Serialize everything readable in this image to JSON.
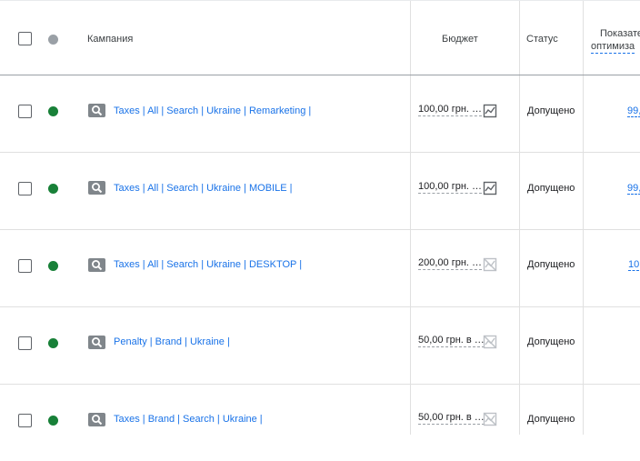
{
  "header": {
    "campaign_label": "Кампания",
    "budget_label": "Бюджет",
    "status_label": "Статус",
    "optimization_label_line1": "Показате",
    "optimization_label_line2": "оптимиза",
    "status_dot_color": "#9aa0a6"
  },
  "colors": {
    "enabled_dot": "#188038",
    "link": "#1a73e8"
  },
  "rows": [
    {
      "campaign": "Taxes | All | Search | Ukraine | Remarketing |",
      "budget": "100,00 грн. …",
      "chart_icon": "chart-line-icon",
      "status": "Допущено",
      "score": "99,"
    },
    {
      "campaign": "Taxes | All | Search | Ukraine | MOBILE |",
      "budget": "100,00 грн. …",
      "chart_icon": "chart-line-icon",
      "status": "Допущено",
      "score": "99,"
    },
    {
      "campaign": "Taxes | All | Search | Ukraine | DESKTOP |",
      "budget": "200,00 грн. …",
      "chart_icon": "chart-disabled-icon",
      "status": "Допущено",
      "score": "10"
    },
    {
      "campaign": "Penalty | Brand | Ukraine |",
      "budget": "50,00 грн. в …",
      "chart_icon": "chart-disabled-icon",
      "status": "Допущено",
      "score": ""
    },
    {
      "campaign": "Taxes | Brand | Search | Ukraine |",
      "budget": "50,00 грн. в …",
      "chart_icon": "chart-disabled-icon",
      "status": "Допущено",
      "score": ""
    }
  ]
}
